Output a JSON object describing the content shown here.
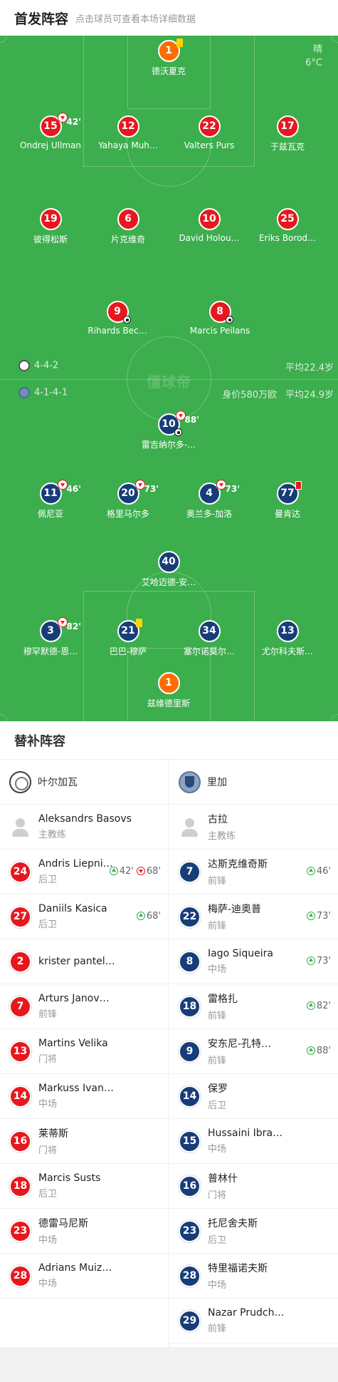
{
  "header": {
    "title": "首发阵容",
    "subtitle": "点击球员可查看本场详细数据"
  },
  "weather": {
    "condition": "晴",
    "temp": "6°C"
  },
  "watermark": "懂球帝",
  "home_team": {
    "formation": "4-4-2",
    "avg_age": "平均22.4岁"
  },
  "away_team": {
    "formation": "4-1-4-1",
    "value": "身价580万欧",
    "avg_age": "平均24.9岁"
  },
  "top_players": [
    {
      "num": "1",
      "name": "德沃夏克",
      "color": "orange",
      "card": "yellow"
    },
    {
      "num": "15",
      "name": "Ondrej Ullman",
      "color": "red",
      "sub_out": "42'"
    },
    {
      "num": "12",
      "name": "Yahaya Muh…",
      "color": "red"
    },
    {
      "num": "22",
      "name": "Valters Purs",
      "color": "red"
    },
    {
      "num": "17",
      "name": "于兹瓦克",
      "color": "red"
    },
    {
      "num": "19",
      "name": "彼得松斯",
      "color": "red"
    },
    {
      "num": "6",
      "name": "片克维奇",
      "color": "red"
    },
    {
      "num": "10",
      "name": "David Holou…",
      "color": "red"
    },
    {
      "num": "25",
      "name": "Eriks Borod…",
      "color": "red"
    },
    {
      "num": "9",
      "name": "Rihards Bec…",
      "color": "red",
      "ball": "assist"
    },
    {
      "num": "8",
      "name": "Marcis Peilans",
      "color": "red",
      "ball": "goal"
    }
  ],
  "bottom_players": [
    {
      "num": "10",
      "name": "雷吉纳尔多-…",
      "color": "blue",
      "sub_out": "88'",
      "ball": "goal"
    },
    {
      "num": "11",
      "name": "佩尼亚",
      "color": "blue",
      "sub_out": "46'"
    },
    {
      "num": "20",
      "name": "格里马尔多",
      "color": "blue",
      "sub_out": "73'"
    },
    {
      "num": "4",
      "name": "奥兰多-加洛",
      "color": "blue",
      "sub_out": "73'"
    },
    {
      "num": "77",
      "name": "曼肯达",
      "color": "blue",
      "card": "red"
    },
    {
      "num": "40",
      "name": "艾哈迈德-安…",
      "color": "blue"
    },
    {
      "num": "3",
      "name": "穆罕默德-恩…",
      "color": "blue",
      "sub_out": "82'"
    },
    {
      "num": "21",
      "name": "巴巴-穆萨",
      "color": "blue",
      "card": "yellow"
    },
    {
      "num": "34",
      "name": "塞尔诺莫尔…",
      "color": "blue"
    },
    {
      "num": "13",
      "name": "尤尔科夫斯…",
      "color": "blue"
    },
    {
      "num": "1",
      "name": "兹维德里斯",
      "color": "orange"
    }
  ],
  "subs": {
    "title": "替补阵容",
    "home": {
      "team_name": "叶尔加瓦",
      "coach": {
        "name": "Aleksandrs Basovs",
        "role": "主教练"
      },
      "players": [
        {
          "num": "24",
          "name": "Andris Liepni…",
          "pos": "后卫",
          "in": "42'",
          "out": "68'"
        },
        {
          "num": "27",
          "name": "Daniils Kasica",
          "pos": "后卫",
          "in": "68'"
        },
        {
          "num": "2",
          "name": "krister pantel…",
          "pos": ""
        },
        {
          "num": "7",
          "name": "Arturs Janov…",
          "pos": "前锋"
        },
        {
          "num": "13",
          "name": "Martins Velika",
          "pos": "门将"
        },
        {
          "num": "14",
          "name": "Markuss Ivan…",
          "pos": "中场"
        },
        {
          "num": "16",
          "name": "莱蒂斯",
          "pos": "门将"
        },
        {
          "num": "18",
          "name": "Marcis Susts",
          "pos": "后卫"
        },
        {
          "num": "23",
          "name": "德雷马尼斯",
          "pos": "中场"
        },
        {
          "num": "28",
          "name": "Adrians Muiz…",
          "pos": "中场"
        }
      ]
    },
    "away": {
      "team_name": "里加",
      "coach": {
        "name": "古拉",
        "role": "主教练"
      },
      "players": [
        {
          "num": "7",
          "name": "达斯克维奇斯",
          "pos": "前锋",
          "in": "46'"
        },
        {
          "num": "22",
          "name": "梅萨-迪奥普",
          "pos": "前锋",
          "in": "73'"
        },
        {
          "num": "8",
          "name": "Iago Siqueira",
          "pos": "中场",
          "in": "73'"
        },
        {
          "num": "18",
          "name": "雷格扎",
          "pos": "前锋",
          "in": "82'"
        },
        {
          "num": "9",
          "name": "安东尼-孔特…",
          "pos": "前锋",
          "in": "88'"
        },
        {
          "num": "14",
          "name": "保罗",
          "pos": "后卫"
        },
        {
          "num": "15",
          "name": "Hussaini Ibra…",
          "pos": "中场"
        },
        {
          "num": "16",
          "name": "普林什",
          "pos": "门将"
        },
        {
          "num": "23",
          "name": "托尼舍夫斯",
          "pos": "后卫"
        },
        {
          "num": "28",
          "name": "特里福诺夫斯",
          "pos": "中场"
        },
        {
          "num": "29",
          "name": "Nazar Prudch…",
          "pos": "前锋"
        }
      ]
    }
  }
}
